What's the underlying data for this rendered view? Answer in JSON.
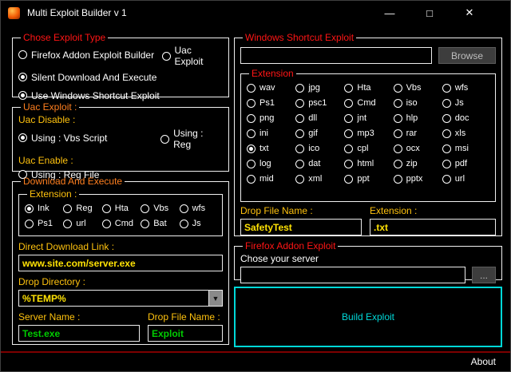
{
  "window": {
    "title": "Multi Exploit Builder v 1",
    "minimize_glyph": "—",
    "maximize_glyph": "□",
    "close_glyph": "✕"
  },
  "palette": {
    "background": "#000000",
    "group_border": "#f0f0f0",
    "title_red": "#ff1515",
    "title_orange": "#ff7f1f",
    "label_yellow": "#ffc20e",
    "input_yellow": "#ffe204",
    "input_green": "#00cc00",
    "build_cyan": "#00d8d8",
    "footer_red": "#7d0000"
  },
  "exploit_type": {
    "title": "Chose Exploit Type",
    "options": [
      {
        "label": "Firefox Addon Exploit Builder",
        "selected": false
      },
      {
        "label": "Uac Exploit",
        "selected": false
      },
      {
        "label": "Silent Download And Execute",
        "selected": true
      },
      {
        "label": "Use Windows Shortcut Exploit",
        "selected": true
      }
    ]
  },
  "uac_exploit": {
    "title": "Uac Exploit :",
    "disable_label": "Uac Disable :",
    "enable_label": "Uac Enable :",
    "disable_options": [
      {
        "label": "Using : Vbs Script",
        "selected": true
      },
      {
        "label": "Using : Reg",
        "selected": false
      }
    ],
    "enable_options": [
      {
        "label": "Using : Reg File",
        "selected": false
      }
    ]
  },
  "download_execute": {
    "title": "Download And Execute",
    "extension_group": {
      "title": "Extension :",
      "options": [
        {
          "label": "Ink",
          "selected": true
        },
        {
          "label": "Reg",
          "selected": false
        },
        {
          "label": "Hta",
          "selected": false
        },
        {
          "label": "Vbs",
          "selected": false
        },
        {
          "label": "wfs",
          "selected": false
        },
        {
          "label": "Ps1",
          "selected": false
        },
        {
          "label": "url",
          "selected": false
        },
        {
          "label": "Cmd",
          "selected": false
        },
        {
          "label": "Bat",
          "selected": false
        },
        {
          "label": "Js",
          "selected": false
        }
      ]
    },
    "direct_link_label": "Direct Download Link :",
    "direct_link_value": "www.site.com/server.exe",
    "drop_directory_label": "Drop Directory :",
    "drop_directory_value": "%TEMP%",
    "server_name_label": "Server Name :",
    "server_name_value": "Test.exe",
    "drop_file_label": "Drop File Name :",
    "drop_file_value": "Exploit"
  },
  "shortcut_exploit": {
    "title": "Windows Shortcut Exploit",
    "path_value": "",
    "browse_label": "Browse",
    "extension_group": {
      "title": "Extension",
      "options": [
        {
          "label": "wav",
          "selected": false
        },
        {
          "label": "jpg",
          "selected": false
        },
        {
          "label": "Hta",
          "selected": false
        },
        {
          "label": "Vbs",
          "selected": false
        },
        {
          "label": "wfs",
          "selected": false
        },
        {
          "label": "Ps1",
          "selected": false
        },
        {
          "label": "psc1",
          "selected": false
        },
        {
          "label": "Cmd",
          "selected": false
        },
        {
          "label": "iso",
          "selected": false
        },
        {
          "label": "Js",
          "selected": false
        },
        {
          "label": "png",
          "selected": false
        },
        {
          "label": "dll",
          "selected": false
        },
        {
          "label": "jnt",
          "selected": false
        },
        {
          "label": "hlp",
          "selected": false
        },
        {
          "label": "doc",
          "selected": false
        },
        {
          "label": "ini",
          "selected": false
        },
        {
          "label": "gif",
          "selected": false
        },
        {
          "label": "mp3",
          "selected": false
        },
        {
          "label": "rar",
          "selected": false
        },
        {
          "label": "xls",
          "selected": false
        },
        {
          "label": "txt",
          "selected": true
        },
        {
          "label": "ico",
          "selected": false
        },
        {
          "label": "cpl",
          "selected": false
        },
        {
          "label": "ocx",
          "selected": false
        },
        {
          "label": "msi",
          "selected": false
        },
        {
          "label": "log",
          "selected": false
        },
        {
          "label": "dat",
          "selected": false
        },
        {
          "label": "html",
          "selected": false
        },
        {
          "label": "zip",
          "selected": false
        },
        {
          "label": "pdf",
          "selected": false
        },
        {
          "label": "mid",
          "selected": false
        },
        {
          "label": "xml",
          "selected": false
        },
        {
          "label": "ppt",
          "selected": false
        },
        {
          "label": "pptx",
          "selected": false
        },
        {
          "label": "url",
          "selected": false
        }
      ]
    },
    "drop_file_label": "Drop File Name :",
    "drop_file_value": "SafetyTest",
    "extension_label": "Extension :",
    "extension_value": ".txt"
  },
  "firefox_exploit": {
    "title": "Firefox Addon Exploit",
    "server_label": "Chose your server",
    "server_value": "",
    "browse_label": "..."
  },
  "build_button_label": "Build Exploit",
  "footer": {
    "about_label": "About"
  }
}
